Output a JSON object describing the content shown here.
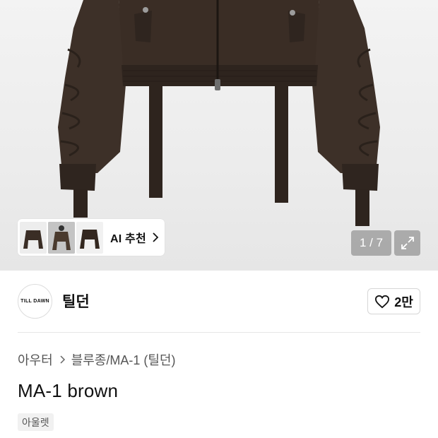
{
  "gallery": {
    "ai_recommend_label": "AI 추천",
    "counter": "1 / 7",
    "thumbnails": [
      "jacket-thumb-1",
      "jacket-thumb-2",
      "jacket-thumb-3"
    ],
    "expand_icon": "expand-icon",
    "product_color": "#3a2d25"
  },
  "seller": {
    "logo_text": "TILL DAWN",
    "name": "틸던",
    "like_count": "2만",
    "like_icon": "heart-outline-icon"
  },
  "product": {
    "breadcrumb": [
      "아우터",
      "블루종/MA-1 (틸던)"
    ],
    "title": "MA-1 brown",
    "tag": "아울렛"
  }
}
